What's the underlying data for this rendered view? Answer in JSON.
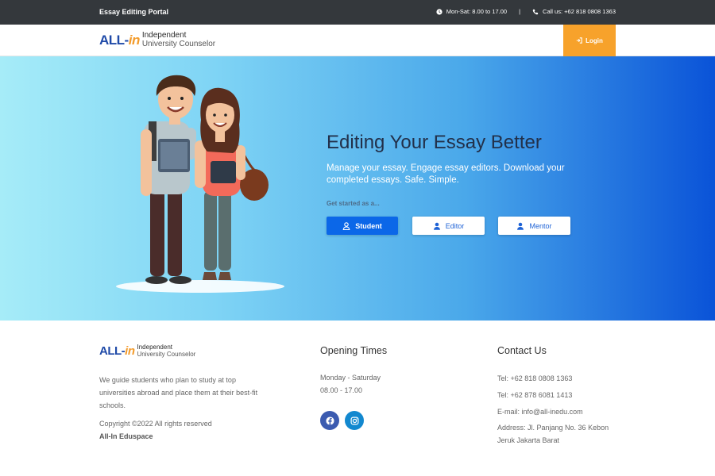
{
  "topbar": {
    "brand": "Essay Editing Portal",
    "hours_icon": "clock-icon",
    "hours": "Mon-Sat: 8.00 to 17.00",
    "separator": "|",
    "phone_icon": "phone-icon",
    "phone": "Call us: +62 818 0808 1363"
  },
  "navbar": {
    "logo": {
      "mark_a": "ALL-",
      "mark_b": "in",
      "line1": "Independent",
      "line2": "University Counselor"
    },
    "login_icon": "sign-in-icon",
    "login_label": "Login",
    "login_color": "#f7a22b"
  },
  "hero": {
    "title": "Editing Your Essay Better",
    "description": "Manage your essay. Engage essay editors. Download your completed essays. Safe. Simple.",
    "prompt": "Get started as a...",
    "buttons": [
      {
        "label": "Student",
        "icon": "user-icon"
      },
      {
        "label": "Editor",
        "icon": "user-icon"
      },
      {
        "label": "Mentor",
        "icon": "user-icon"
      }
    ],
    "gradient": [
      "#a6ecf8",
      "#0a53d8"
    ]
  },
  "footer": {
    "logo": {
      "mark_a": "ALL-",
      "mark_b": "in",
      "line1": "Independent",
      "line2": "University Counselor"
    },
    "about": "We guide students who plan to study at top universities abroad and place them at their best-fit schools.",
    "copyright": "Copyright ©2022 All rights reserved",
    "company": "All-In Eduspace",
    "opening": {
      "heading": "Opening Times",
      "days": "Monday - Saturday",
      "hours": "08.00 - 17.00"
    },
    "social": [
      {
        "icon": "facebook-icon",
        "color": "#3b5bb0"
      },
      {
        "icon": "instagram-icon",
        "color": "#1288cf"
      }
    ],
    "contact": {
      "heading": "Contact Us",
      "tel1": "Tel: +62 818 0808 1363",
      "tel2": "Tel: +62 878 6081 1413",
      "email": "E-mail: info@all-inedu.com",
      "address": "Address: Jl. Panjang No. 36 Kebon Jeruk Jakarta Barat"
    }
  }
}
